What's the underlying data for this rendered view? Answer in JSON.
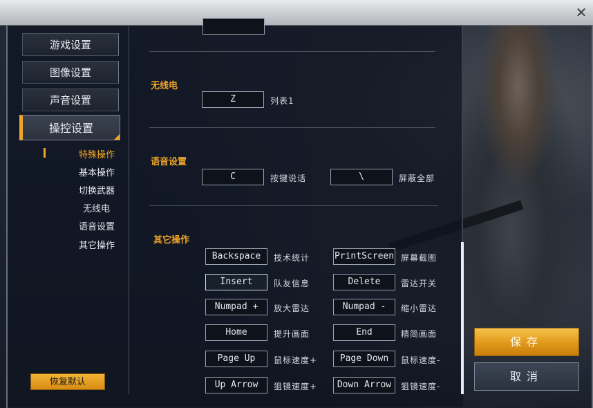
{
  "window": {
    "close_icon": "close-icon"
  },
  "sidebar": {
    "menu": [
      {
        "label": "游戏设置",
        "active": false
      },
      {
        "label": "图像设置",
        "active": false
      },
      {
        "label": "声音设置",
        "active": false
      },
      {
        "label": "操控设置",
        "active": true
      }
    ],
    "submenu": [
      {
        "label": "特殊操作",
        "active": true
      },
      {
        "label": "基本操作",
        "active": false
      },
      {
        "label": "切换武器",
        "active": false
      },
      {
        "label": "无线电",
        "active": false
      },
      {
        "label": "语音设置",
        "active": false
      },
      {
        "label": "其它操作",
        "active": false
      }
    ],
    "restore_label": "恢复默认"
  },
  "content": {
    "radio": {
      "title": "无线电",
      "bindings": [
        {
          "key": "Z",
          "label": "列表1"
        }
      ]
    },
    "voice": {
      "title": "语音设置",
      "bindings": [
        {
          "key": "C",
          "label": "按键说话"
        },
        {
          "key": "\\",
          "label": "屏蔽全部"
        }
      ]
    },
    "other": {
      "title": "其它操作",
      "bindings": [
        {
          "key": "Backspace",
          "label": "技术统计"
        },
        {
          "key": "PrintScreen",
          "label": "屏幕截图"
        },
        {
          "key": "Insert",
          "label": "队友信息"
        },
        {
          "key": "Delete",
          "label": "雷达开关"
        },
        {
          "key": "Numpad +",
          "label": "放大雷达"
        },
        {
          "key": "Numpad -",
          "label": "缩小雷达"
        },
        {
          "key": "Home",
          "label": "提升画面"
        },
        {
          "key": "End",
          "label": "精简画面"
        },
        {
          "key": "Page Up",
          "label": "鼠标速度+"
        },
        {
          "key": "Page Down",
          "label": "鼠标速度-"
        },
        {
          "key": "Up Arrow",
          "label": "狙镜速度+"
        },
        {
          "key": "Down Arrow",
          "label": "狙镜速度-"
        }
      ]
    }
  },
  "buttons": {
    "save": "保存",
    "cancel": "取消"
  },
  "colors": {
    "accent": "#f0a52a",
    "panel": "#1b2230"
  }
}
